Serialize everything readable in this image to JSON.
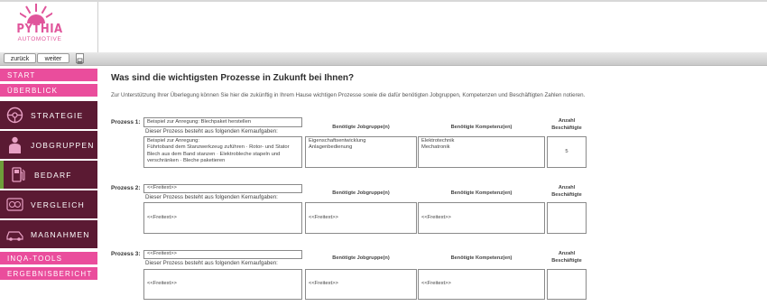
{
  "logo": {
    "name": "PYTHIA",
    "sub": "AUTOMOTIVE"
  },
  "nav": {
    "back": "zurück",
    "forward": "weiter"
  },
  "sidebar": {
    "start": "START",
    "overview": "ÜBERBLICK",
    "strategy": "STRATEGIE",
    "jobgroups": "JOBGRUPPEN",
    "demand": "BEDARF",
    "comparison": "VERGLEICH",
    "measures": "MAßNAHMEN",
    "inqa_tools": "INQA-TOOLS",
    "report": "ERGEBNISBERICHT"
  },
  "main": {
    "title": "Was sind die wichtigsten Prozesse in Zukunft bei Ihnen?",
    "intro": "Zur Unterstützung Ihrer Überlegung können Sie hier die zukünftig in Ihrem Hause wichtigen Prozesse sowie die dafür benötigten Jobgruppen, Kompetenzen und Beschäftigten Zahlen notieren.",
    "col_jobgroups": "Benötigte Jobgruppe(n)",
    "col_competencies": "Benötigte Kompetenz(en)",
    "col_count_1": "Anzahl",
    "col_count_2": "Beschäftigte",
    "core_tasks_label": "Dieser Prozess besteht aus folgenden Kernaufgaben:",
    "processes": [
      {
        "label": "Prozess 1:",
        "name": "Beispiel zur Anregung: Blechpaket herstellen",
        "tasks": "Beispiel zur Anregung:\nFührtoband dem Stanzwerkzeug zuführen · Rotor- und Stator Blech aus dem Band stanzen · Elektrobleche stapeln und verschränken · Bleche paketieren",
        "jobgroups": "Eigenschaftsentwicklung\nAnlagenbedienung",
        "competencies": "Elektrotechnik\nMechatronik",
        "count": "5"
      },
      {
        "label": "Prozess 2:",
        "name": "<<Freitext>>",
        "tasks": "<<Freitext>>",
        "jobgroups": "<<Freitext>>",
        "competencies": "<<Freitext>>",
        "count": ""
      },
      {
        "label": "Prozess 3:",
        "name": "<<Freitext>>",
        "tasks": "<<Freitext>>",
        "jobgroups": "<<Freitext>>",
        "competencies": "<<Freitext>>",
        "count": ""
      }
    ]
  },
  "colors": {
    "pink": "#ea4d9c",
    "dark": "#5b1a33",
    "accent_green": "#6e9e3a"
  }
}
